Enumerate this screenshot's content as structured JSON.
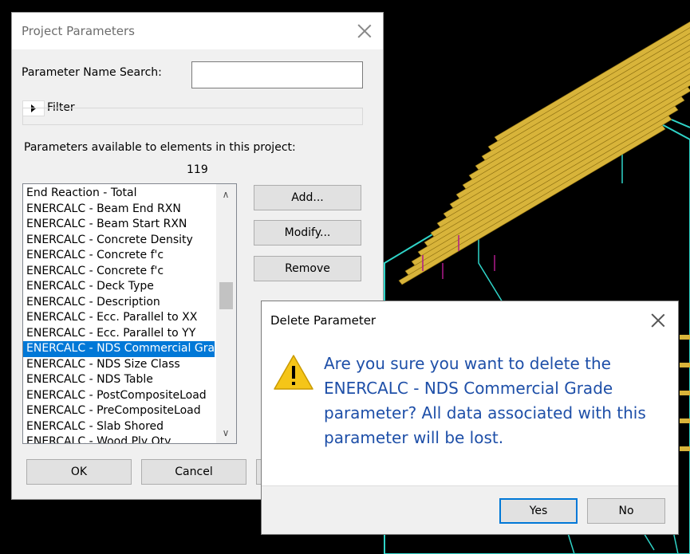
{
  "project_parameters": {
    "title": "Project Parameters",
    "search_label": "Parameter Name Search:",
    "search_value": "",
    "filter_label": "Filter",
    "available_label": "Parameters available to elements in this project:",
    "count": "119",
    "items": [
      "End Reaction - Total",
      "ENERCALC - Beam End RXN",
      "ENERCALC - Beam Start RXN",
      "ENERCALC - Concrete Density",
      "ENERCALC - Concrete f'c",
      "ENERCALC - Concrete f'c",
      "ENERCALC - Deck Type",
      "ENERCALC - Description",
      "ENERCALC - Ecc. Parallel to XX",
      "ENERCALC - Ecc. Parallel to YY",
      "ENERCALC - NDS Commercial Gra",
      "ENERCALC - NDS Size Class",
      "ENERCALC - NDS Table",
      "ENERCALC - PostCompositeLoad",
      "ENERCALC - PreCompositeLoad",
      "ENERCALC - Slab Shored",
      "ENERCALC - Wood Ply Qty"
    ],
    "selected_index": 10,
    "buttons": {
      "add": "Add...",
      "modify": "Modify...",
      "remove": "Remove",
      "ok": "OK",
      "cancel": "Cancel"
    }
  },
  "delete_dialog": {
    "title": "Delete Parameter",
    "message": "Are you sure you want to delete the ENERCALC - NDS Commercial Grade parameter? All data associated with this parameter will be lost.",
    "yes": "Yes",
    "no": "No"
  },
  "colors": {
    "viewport_bg": "#000000",
    "model_cyan": "#2fd4c8",
    "joist_yellow": "#d8b43a",
    "load_magenta": "#b01a8c",
    "selection_blue": "#0078d7",
    "message_blue": "#1e4fa8"
  }
}
